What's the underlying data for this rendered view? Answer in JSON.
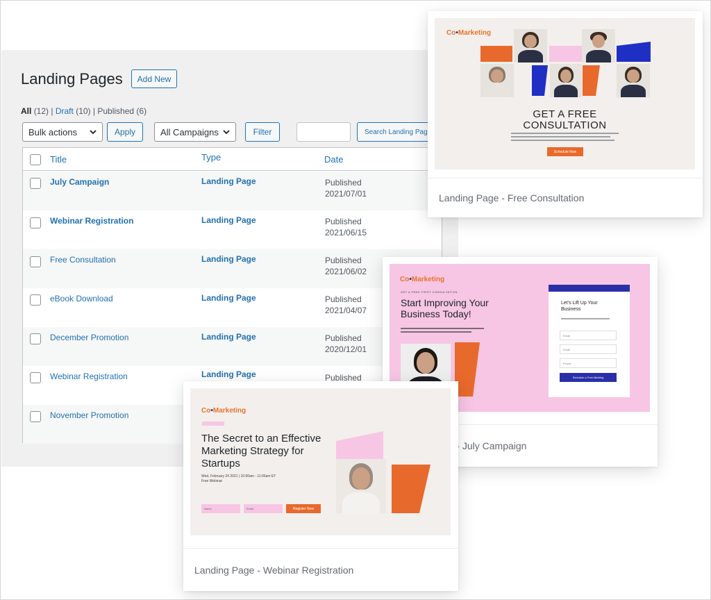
{
  "admin": {
    "title": "Landing Pages",
    "add_new": "Add New",
    "filters": {
      "all_label": "All",
      "all_count": "(12)",
      "sep": "|",
      "draft_label": "Draft",
      "draft_count": "(10)",
      "published_label": "Published",
      "published_count": "(6)"
    },
    "bulk_actions": "Bulk actions",
    "apply": "Apply",
    "campaigns_select": "All Campaigns",
    "filter": "Filter",
    "search_button": "Search Landing Pages",
    "columns": {
      "title": "Title",
      "type": "Type",
      "date": "Date"
    },
    "rows": [
      {
        "title": "July Campaign",
        "type": "Landing Page",
        "status": "Published",
        "date": "2021/07/01",
        "bold": true
      },
      {
        "title": "Webinar Registration",
        "type": "Landing Page",
        "status": "Published",
        "date": "2021/06/15",
        "bold": true
      },
      {
        "title": "Free Consultation",
        "type": "Landing Page",
        "status": "Published",
        "date": "2021/06/02",
        "bold": false
      },
      {
        "title": "eBook Download",
        "type": "Landing Page",
        "status": "Published",
        "date": "2021/04/07",
        "bold": false
      },
      {
        "title": "December Promotion",
        "type": "Landing Page",
        "status": "Published",
        "date": "2020/12/01",
        "bold": false
      },
      {
        "title": "Webinar Registration",
        "type": "Landing Page",
        "status": "Published",
        "date": "",
        "bold": false
      },
      {
        "title": "November Promotion",
        "type": "",
        "status": "",
        "date": "",
        "bold": false
      }
    ]
  },
  "cards": {
    "consultation": {
      "caption": "Landing Page - Free Consultation",
      "logo_a": "Co",
      "logo_b": "Marketing",
      "headline_1": "GET A FREE",
      "headline_2": "CONSULTATION",
      "cta": "Schedule Now"
    },
    "july": {
      "caption": "Landing Page - July Campaign",
      "logo_a": "Co",
      "logo_b": "Marketing",
      "pre_tag": "GET A FREE FIRST CONSULTATION",
      "headline": "Start Improving Your Business Today!",
      "form_title": "Let's Lift Up Your Business",
      "fields": [
        "Email",
        "Email",
        "Phone"
      ],
      "submit": "Schedule a Free Meeting"
    },
    "webinar": {
      "caption": "Landing Page - Webinar Registration",
      "logo_a": "Co",
      "logo_b": "Marketing",
      "headline": "The Secret to an Effective Marketing Strategy for Startups",
      "sub": "Wed, February 24 2021 | 10:00am - 11:00am ET",
      "sub2": "Free Webinar",
      "field_1": "Name",
      "field_2": "Email",
      "cta": "Register Now"
    }
  },
  "colors": {
    "wp_blue": "#2271b1",
    "orange": "#e8692c",
    "royal_blue": "#1f2fc4",
    "pink": "#f7c6e4"
  }
}
